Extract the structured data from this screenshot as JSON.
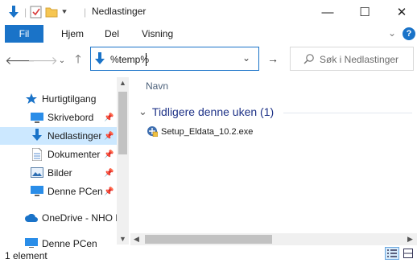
{
  "window": {
    "title": "Nedlastinger",
    "minimize_glyph": "—",
    "maximize_glyph": "☐",
    "close_glyph": "✕"
  },
  "ribbon": {
    "tabs": [
      "Fil",
      "Hjem",
      "Del",
      "Visning"
    ],
    "help_label": "?"
  },
  "address_bar": {
    "value": "%temp%"
  },
  "search": {
    "placeholder": "Søk i Nedlastinger"
  },
  "navigation_pane": {
    "items": [
      {
        "label": "Hurtigtilgang",
        "icon": "star-icon",
        "pinned": false
      },
      {
        "label": "Skrivebord",
        "icon": "desktop-icon",
        "pinned": true
      },
      {
        "label": "Nedlastinger",
        "icon": "download-icon",
        "pinned": true,
        "selected": true
      },
      {
        "label": "Dokumenter",
        "icon": "document-icon",
        "pinned": true
      },
      {
        "label": "Bilder",
        "icon": "pictures-icon",
        "pinned": true
      },
      {
        "label": "Denne PCen",
        "icon": "computer-icon",
        "pinned": true
      },
      {
        "label": "OneDrive - NHO F",
        "icon": "cloud-icon",
        "pinned": false
      },
      {
        "label": "Denne PCen",
        "icon": "computer-icon",
        "pinned": false
      }
    ]
  },
  "content": {
    "column_header": "Navn",
    "group_header": "Tidligere denne uken (1)",
    "files": [
      {
        "name": "Setup_Eldata_10.2.exe",
        "icon": "installer-icon"
      }
    ]
  },
  "status_bar": {
    "item_count": "1 element"
  }
}
